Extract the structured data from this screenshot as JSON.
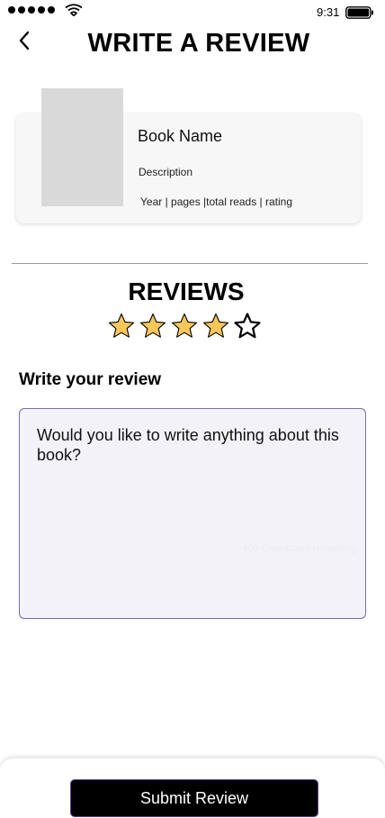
{
  "status_bar": {
    "time": "9:31"
  },
  "header": {
    "title": "WRITE A REVIEW",
    "back_icon": "chevron-left-icon"
  },
  "book": {
    "name": "Book Name",
    "description": "Description",
    "meta": "Year | pages |total reads | rating"
  },
  "reviews": {
    "heading": "REVIEWS",
    "rating": 4,
    "max_rating": 5,
    "star_fill_color": "#f7c75a",
    "star_outline_color": "#000000"
  },
  "write_review": {
    "label": "Write your review",
    "placeholder": "Would you like to write anything about this book?",
    "chars_remaining": "400 Characters remaining",
    "box_bg_color": "#f4f2f9",
    "box_border_color": "#7c6aa8"
  },
  "footer": {
    "submit_label": "Submit Review"
  }
}
